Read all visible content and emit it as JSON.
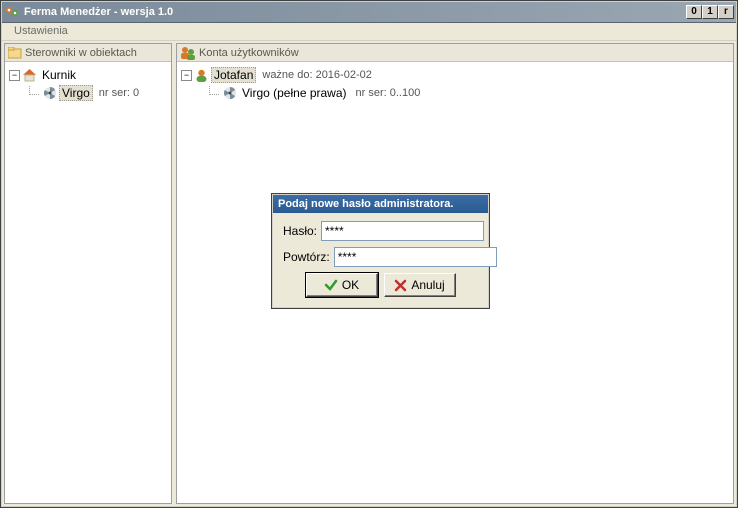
{
  "window": {
    "title": "Ferma Menedżer - wersja 1.0",
    "menu": {
      "settings": "Ustawienia"
    }
  },
  "panels": {
    "left": {
      "header": "Sterowniki w obiektach",
      "root_label": "Kurnik",
      "child_label": "Virgo",
      "child_sub": "nr ser: 0"
    },
    "right": {
      "header": "Konta użytkowników",
      "root_label": "Jotafan",
      "root_sub": "ważne do: 2016-02-02",
      "child_label": "Virgo (pełne prawa)",
      "child_sub": "nr ser: 0..100"
    }
  },
  "dialog": {
    "title": "Podaj nowe hasło administratora.",
    "password_label": "Hasło:",
    "password_value": "****",
    "repeat_label": "Powtórz:",
    "repeat_value": "****",
    "ok_label": "OK",
    "cancel_label": "Anuluj"
  },
  "icons": {
    "minimize": "0",
    "maximize": "1",
    "close": "r"
  }
}
